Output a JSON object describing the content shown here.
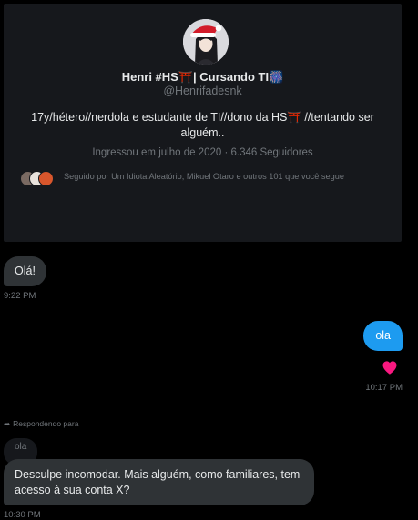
{
  "profile": {
    "name": "Henri #HS⛩️| Cursando TI🎆",
    "handle": "@Henrifadesnk",
    "bio": "17y/hétero//nerdola e estudante de TI//dono da HS⛩️ //tentando ser alguém..",
    "joined": "Ingressou em julho de 2020",
    "separator": "·",
    "followers": "6.346 Seguidores",
    "followed_by": "Seguido por Um Idiota Aleatório, Mikuel Otaro e outros 101 que você segue"
  },
  "messages": [
    {
      "text": "Olá!",
      "time": "9:22 PM",
      "direction": "incoming"
    },
    {
      "text": "ola",
      "time": "10:17 PM",
      "direction": "outgoing",
      "reaction": "heart-icon"
    }
  ],
  "reply": {
    "label": "Respondendo para",
    "quoted": "ola",
    "text": "Desculpe incomodar. Mais alguém, como familiares, tem acesso à sua conta X?",
    "time": "10:30 PM"
  },
  "colors": {
    "background": "#000000",
    "card": "#16181c",
    "incoming_bubble": "#2f3336",
    "outgoing_bubble": "#1d9bf0",
    "muted_text": "#71767b",
    "heart": "#f91880"
  }
}
